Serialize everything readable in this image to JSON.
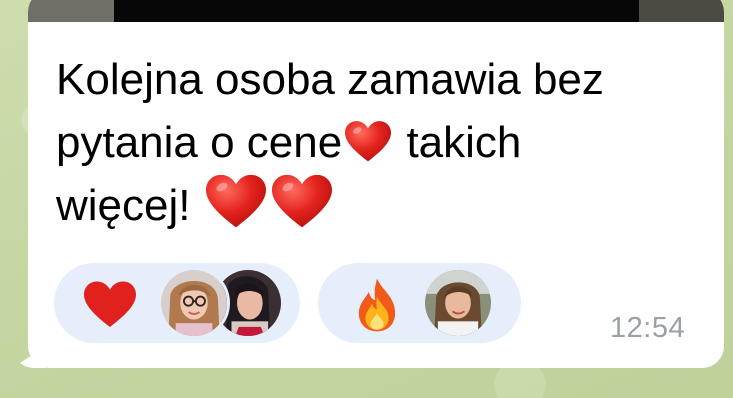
{
  "message": {
    "text_line1": "Kolejna osoba zamawia bez",
    "text_line2_part1": "pytania o cene",
    "text_line2_part2": " takich",
    "text_line3": "więcej! ",
    "inline_emoji": [
      "red-heart-icon",
      "red-heart-icon",
      "red-heart-icon"
    ],
    "time": "12:54"
  },
  "reactions": [
    {
      "emoji": "red-heart-icon",
      "reactors": [
        "avatar-woman-glasses",
        "avatar-woman-dark-hair"
      ]
    },
    {
      "emoji": "fire-icon",
      "reactors": [
        "avatar-woman-outdoor"
      ]
    }
  ],
  "colors": {
    "bubble": "#ffffff",
    "reaction_pill": "#e7eefb",
    "timestamp": "#9aa0a6",
    "wallpaper": "#c9d9a8",
    "heart": "#e0211d"
  }
}
